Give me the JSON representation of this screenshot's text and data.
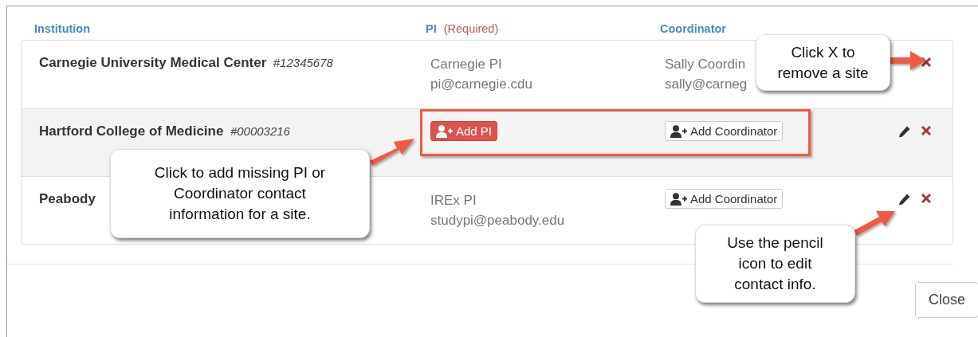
{
  "columns": [
    {
      "label": "Institution"
    },
    {
      "label": "PI",
      "note": "(Required)"
    },
    {
      "label": "Coordinator"
    }
  ],
  "rows": [
    {
      "institution": "Carnegie University Medical Center",
      "number": "#12345678",
      "shaded": false,
      "edit_visible": false,
      "pi": {
        "kind": "contact",
        "name": "Carnegie PI",
        "email": "pi@carnegie.cdu"
      },
      "coordinator": {
        "kind": "contact",
        "name": "Sally Coordin",
        "email": "sally@carneg"
      }
    },
    {
      "institution": "Hartford College of Medicine",
      "number": "#00003216",
      "shaded": true,
      "edit_visible": true,
      "pi": {
        "kind": "add_button",
        "label": "Add PI"
      },
      "coordinator": {
        "kind": "add_button",
        "label": "Add Coordinator"
      }
    },
    {
      "institution": "Peabody",
      "shaded": false,
      "edit_visible": true,
      "pi": {
        "kind": "contact",
        "name": "IREx PI",
        "email": "studypi@peabody.edu"
      },
      "coordinator": {
        "kind": "add_button",
        "label": "Add Coordinator"
      }
    }
  ],
  "callouts": [
    {
      "text": "Click X to remove a site"
    },
    {
      "text": "Click to add missing PI or Coordinator contact information for a site."
    },
    {
      "text": "Use the pencil icon to edit contact info."
    }
  ],
  "close_button": "Close"
}
